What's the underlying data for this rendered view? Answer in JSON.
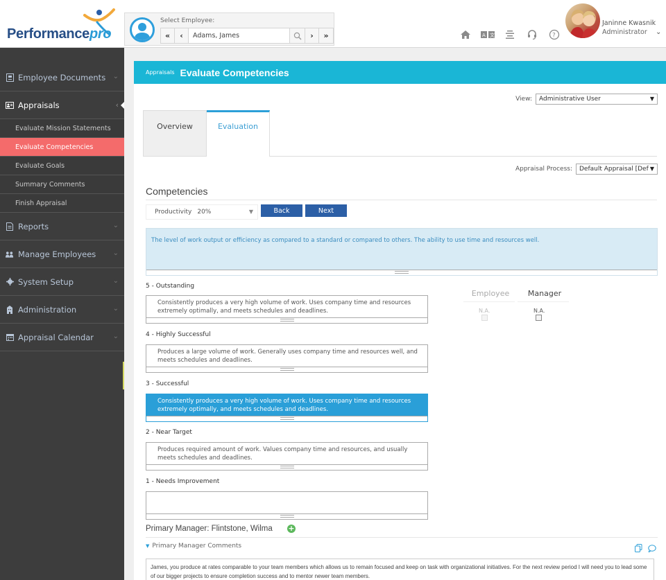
{
  "header": {
    "logo": {
      "text_main": "Performance",
      "text_accent": "pro"
    },
    "employee_selector": {
      "label": "Select Employee:",
      "value": "Adams, James",
      "first_label": "«",
      "prev_label": "‹",
      "next_label": "›",
      "last_label": "»"
    },
    "toolbar_icons": [
      "home-icon",
      "language-icon",
      "list-icon",
      "support-icon",
      "help-icon"
    ],
    "user": {
      "name": "Janinne Kwasnik",
      "role": "Administrator",
      "caret": "⌄"
    }
  },
  "sidebar": {
    "items": [
      {
        "label": "Employee Documents",
        "icon": "document-icon",
        "expanded": false
      },
      {
        "label": "Appraisals",
        "icon": "id-card-icon",
        "expanded": true,
        "children": [
          {
            "label": "Evaluate Mission Statements",
            "active": false
          },
          {
            "label": "Evaluate Competencies",
            "active": true
          },
          {
            "label": "Evaluate Goals",
            "active": false
          },
          {
            "label": "Summary Comments",
            "active": false
          },
          {
            "label": "Finish Appraisal",
            "active": false
          }
        ]
      },
      {
        "label": "Reports",
        "icon": "report-icon",
        "expanded": false
      },
      {
        "label": "Manage Employees",
        "icon": "users-icon",
        "expanded": false
      },
      {
        "label": "System Setup",
        "icon": "gear-icon",
        "expanded": false
      },
      {
        "label": "Administration",
        "icon": "building-icon",
        "expanded": false
      },
      {
        "label": "Appraisal Calendar",
        "icon": "calendar-icon",
        "expanded": false
      }
    ]
  },
  "page": {
    "breadcrumb": "Appraisals",
    "title": "Evaluate Competencies",
    "view": {
      "label": "View:",
      "value": "Administrative User"
    },
    "tabs": [
      {
        "label": "Overview",
        "active": false
      },
      {
        "label": "Evaluation",
        "active": true
      }
    ],
    "appraisal_process": {
      "label": "Appraisal Process:",
      "value": "Default Appraisal [Defa"
    },
    "competencies": {
      "title": "Competencies",
      "selected": {
        "name": "Productivity",
        "weight": "20%"
      },
      "back_label": "Back",
      "next_label": "Next",
      "description": "The level of work output or efficiency as compared to a standard or compared to others. The ability to use time and resources well.",
      "ratings": [
        {
          "label": "5 - Outstanding",
          "text": "Consistently produces a very high volume of work. Uses company time and resources extremely optimally, and meets schedules and deadlines.",
          "selected": false
        },
        {
          "label": "4 - Highly Successful",
          "text": "Produces a large volume of work. Generally uses company time and resources well, and meets schedules and deadlines.",
          "selected": false
        },
        {
          "label": "3 - Successful",
          "text": "Consistently produces a very high volume of work. Uses company time and resources extremely optimally, and meets schedules and deadlines.",
          "selected": true
        },
        {
          "label": "2 - Near Target",
          "text": "Produces required amount of work. Values company time and resources, and usually meets schedules and deadlines.",
          "selected": false
        },
        {
          "label": "1 - Needs Improvement",
          "text": "",
          "selected": false
        }
      ],
      "columns": {
        "employee": {
          "label": "Employee",
          "na_label": "N.A.",
          "checked": false,
          "enabled": false
        },
        "manager": {
          "label": "Manager",
          "na_label": "N.A.",
          "checked": false,
          "enabled": true
        }
      }
    },
    "primary_manager": {
      "title": "Primary Manager: Flintstone, Wilma",
      "comments_label": "Primary Manager Comments",
      "comment": "James, you produce at rates comparable to your team members which allows us to remain focused and keep on task with organizational initiatives. For the next review period I will need you to lead some of our bigger projects to ensure completion success and to mentor newer team members."
    }
  },
  "colors": {
    "title_bar": "#1ab6d6",
    "sidebar_bg": "#3d3d3d",
    "sidebar_active": "#f46b6b",
    "button_primary": "#2c5fa6",
    "selected_rating": "#2a9fd8",
    "description_bg": "#d8ebf5"
  }
}
